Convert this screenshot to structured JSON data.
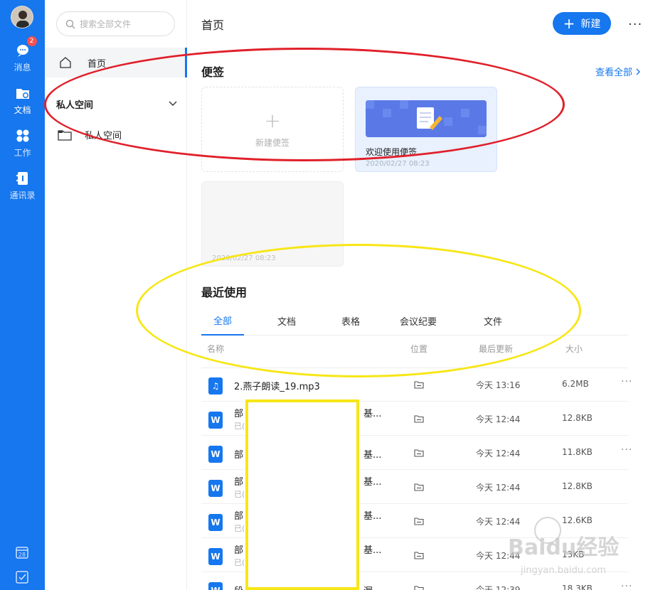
{
  "rail": {
    "items": [
      {
        "label": "消息",
        "icon": "chat-icon",
        "badge": "2"
      },
      {
        "label": "文档",
        "icon": "doc-cloud-icon"
      },
      {
        "label": "工作",
        "icon": "apps-icon"
      },
      {
        "label": "通讯录",
        "icon": "contacts-icon"
      }
    ],
    "calendar_day": "28",
    "accent": "#1677ee"
  },
  "sidebar": {
    "search_placeholder": "搜索全部文件",
    "home_label": "首页",
    "section_label": "私人空间",
    "folder_label": "私人空间"
  },
  "header": {
    "title": "首页",
    "new_button": "新建"
  },
  "notes": {
    "title": "便签",
    "view_all": "查看全部",
    "new_note": "新建便签",
    "welcome_title": "欢迎使用便签",
    "welcome_time": "2020/02/27 08:23",
    "blank_time": "2020/02/27 08:23"
  },
  "recent": {
    "title": "最近使用",
    "tabs": [
      "全部",
      "文档",
      "表格",
      "会议纪要",
      "文件"
    ],
    "columns": {
      "name": "名称",
      "location": "位置",
      "updated": "最后更新",
      "size": "大小"
    },
    "rows": [
      {
        "type": "audio",
        "icon_glyph": "♫",
        "name": "2.燕子朗读_19.mp3",
        "sub": "",
        "tail": "",
        "time": "今天 13:16",
        "size": "6.2MB",
        "more": true
      },
      {
        "type": "word",
        "icon_glyph": "W",
        "name": "部",
        "sub": "已(",
        "tail": "基...",
        "time": "今天 12:44",
        "size": "12.8KB",
        "more": false
      },
      {
        "type": "word",
        "icon_glyph": "W",
        "name": "部",
        "sub": "",
        "tail": "基...",
        "time": "今天 12:44",
        "size": "11.8KB",
        "more": true
      },
      {
        "type": "word",
        "icon_glyph": "W",
        "name": "部",
        "sub": "已(",
        "tail": "基...",
        "time": "今天 12:44",
        "size": "12.8KB",
        "more": false
      },
      {
        "type": "word",
        "icon_glyph": "W",
        "name": "部",
        "sub": "已(",
        "tail": "基...",
        "time": "今天 12:44",
        "size": "12.6KB",
        "more": false
      },
      {
        "type": "word",
        "icon_glyph": "W",
        "name": "部",
        "sub": "已(",
        "tail": "基...",
        "time": "今天 12:44",
        "size": "13KB",
        "more": false
      },
      {
        "type": "word",
        "icon_glyph": "W",
        "name": "段",
        "sub": "",
        "tail": "漏",
        "time": "今天 12:39",
        "size": "18.3KB",
        "more": true
      }
    ]
  },
  "watermark": {
    "brand": "Baidu经验",
    "url": "jingyan.baidu.com"
  }
}
